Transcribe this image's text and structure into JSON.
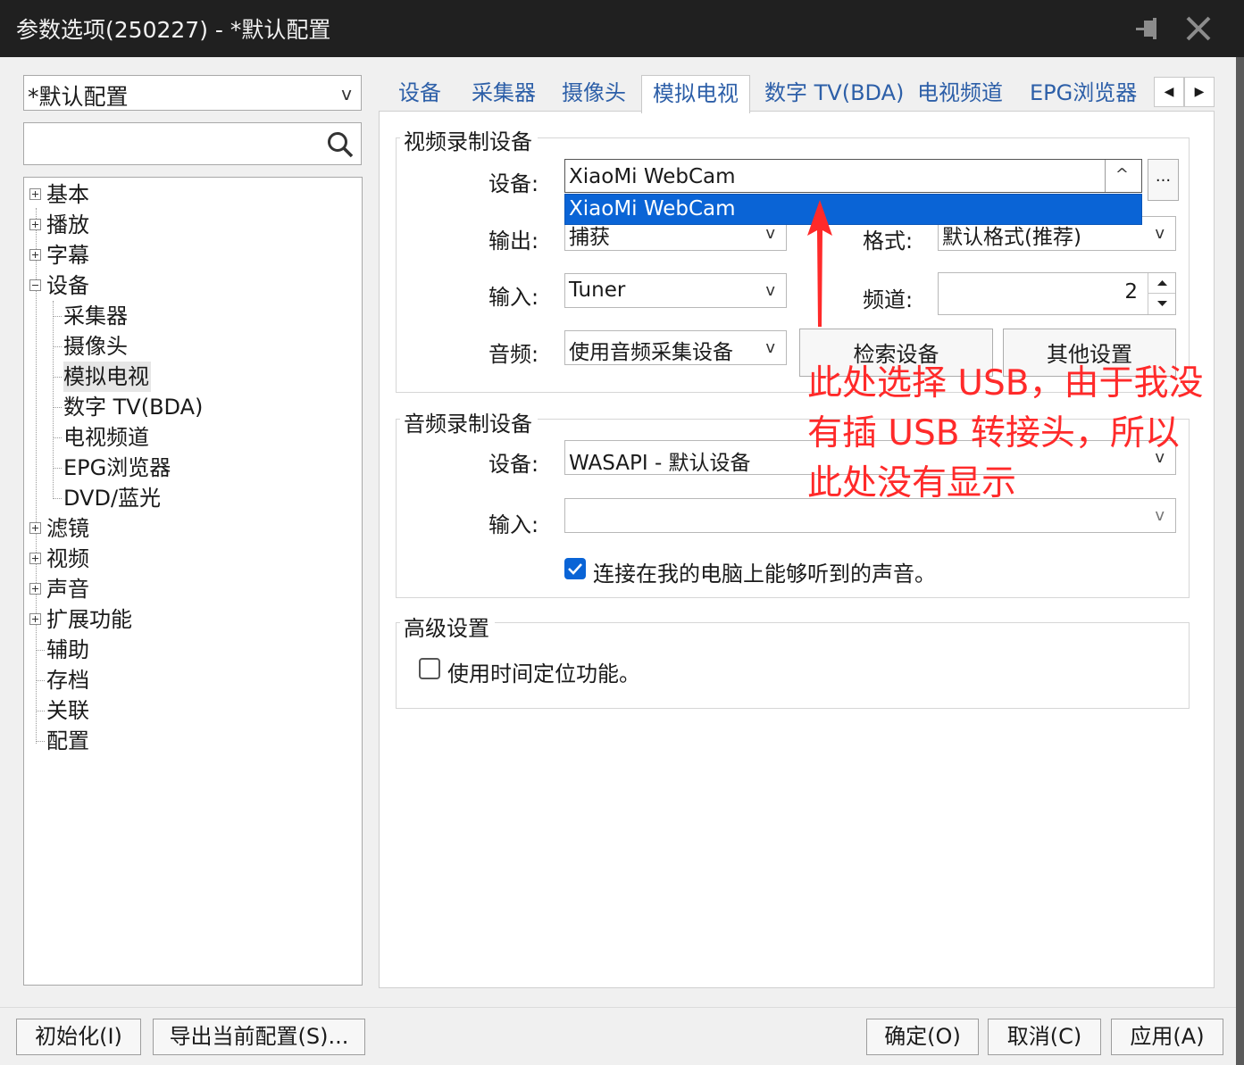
{
  "window": {
    "title": "参数选项(250227) - *默认配置"
  },
  "profile_select": {
    "value": "*默认配置",
    "arrow": "v"
  },
  "tree": {
    "items": [
      {
        "label": "基本"
      },
      {
        "label": "播放"
      },
      {
        "label": "字幕"
      },
      {
        "label": "设备"
      },
      {
        "label": "采集器"
      },
      {
        "label": "摄像头"
      },
      {
        "label": "模拟电视"
      },
      {
        "label": "数字 TV(BDA)"
      },
      {
        "label": "电视频道"
      },
      {
        "label": "EPG浏览器"
      },
      {
        "label": "DVD/蓝光"
      },
      {
        "label": "滤镜"
      },
      {
        "label": "视频"
      },
      {
        "label": "声音"
      },
      {
        "label": "扩展功能"
      },
      {
        "label": "辅助"
      },
      {
        "label": "存档"
      },
      {
        "label": "关联"
      },
      {
        "label": "配置"
      }
    ]
  },
  "tabs": [
    {
      "label": "设备"
    },
    {
      "label": "采集器"
    },
    {
      "label": "摄像头"
    },
    {
      "label": "模拟电视"
    },
    {
      "label": "数字 TV(BDA)"
    },
    {
      "label": "电视频道"
    },
    {
      "label": "EPG浏览器"
    }
  ],
  "tab_nav": {
    "prev": "◀",
    "next": "▶"
  },
  "video_group": {
    "title": "视频录制设备",
    "device_label": "设备:",
    "device_value": "XiaoMi WebCam",
    "device_arrow": "^",
    "more_button": "...",
    "dropdown_option": "XiaoMi WebCam",
    "output_label": "输出:",
    "output_value": "捕获",
    "format_label": "格式:",
    "format_value": "默认格式(推荐)",
    "input_label": "输入:",
    "input_value": "Tuner",
    "channel_label": "频道:",
    "channel_value": "2",
    "audio_label": "音频:",
    "audio_value": "使用音频采集设备",
    "search_button": "检索设备",
    "other_button": "其他设置",
    "arrow": "v"
  },
  "audio_group": {
    "title": "音频录制设备",
    "device_label": "设备:",
    "device_value": "WASAPI - 默认设备",
    "input_label": "输入:",
    "input_value": "",
    "listen_checkbox_label": "连接在我的电脑上能够听到的声音。",
    "listen_checked": true,
    "arrow": "v"
  },
  "advanced_group": {
    "title": "高级设置",
    "timeshift_label": "使用时间定位功能。",
    "timeshift_checked": false
  },
  "annotation": {
    "text": "此处选择 USB，由于我没\n有插 USB 转接头，所以\n此处没有显示",
    "color": "#ff2a2a"
  },
  "footer": {
    "init_button": "初始化(I)",
    "export_button": "导出当前配置(S)...",
    "ok_button": "确定(O)",
    "cancel_button": "取消(C)",
    "apply_button": "应用(A)"
  }
}
